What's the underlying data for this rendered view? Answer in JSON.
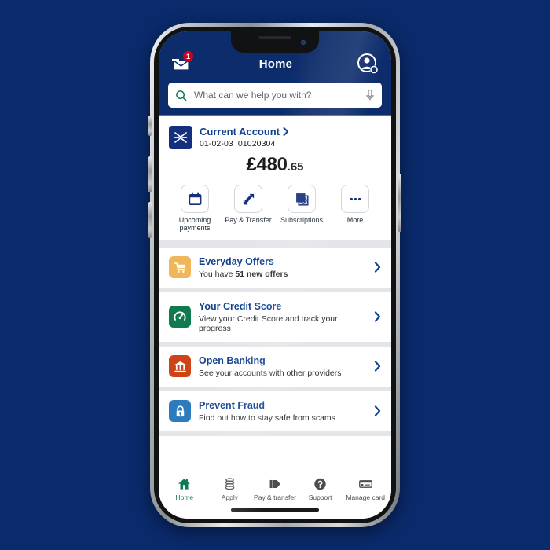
{
  "app": {
    "header": {
      "title": "Home",
      "mail_icon": "envelope-icon",
      "mail_badge": "1",
      "profile_icon": "profile-settings-icon"
    },
    "search": {
      "icon": "search-icon",
      "placeholder": "What can we help you with?",
      "mic_icon": "microphone-icon"
    },
    "account_card": {
      "brand_icon": "bank-emblem-icon",
      "name": "Current Account",
      "chevron": "chevron-right-icon",
      "sort_code": "01-02-03",
      "account_number": "01020304",
      "balance_main": "£480",
      "balance_pence": ".65",
      "actions": [
        {
          "label": "Upcoming payments",
          "icon": "calendar-icon"
        },
        {
          "label": "Pay & Transfer",
          "icon": "arrows-transfer-icon"
        },
        {
          "label": "Subscriptions",
          "icon": "subscriptions-icon"
        },
        {
          "label": "More",
          "icon": "ellipsis-icon"
        }
      ]
    },
    "rows": [
      {
        "title": "Everyday Offers",
        "sub_pre": "You have ",
        "sub_bold": "51 new offers",
        "sub_post": "",
        "icon": "shopping-cart-icon",
        "icon_color": "#f0b65a",
        "chevron": "chevron-right-icon"
      },
      {
        "title": "Your Credit Score",
        "sub_pre": "View your Credit Score and track your progress",
        "sub_bold": "",
        "sub_post": "",
        "icon": "speedometer-icon",
        "icon_color": "#0f7a4e",
        "chevron": "chevron-right-icon"
      },
      {
        "title": "Open Banking",
        "sub_pre": "See your accounts with other providers",
        "sub_bold": "",
        "sub_post": "",
        "icon": "bank-building-icon",
        "icon_color": "#cf4417",
        "chevron": "chevron-right-icon"
      },
      {
        "title": "Prevent Fraud",
        "sub_pre": "Find out how to stay safe from scams",
        "sub_bold": "",
        "sub_post": "",
        "icon": "padlock-icon",
        "icon_color": "#2c7bbf",
        "chevron": "chevron-right-icon"
      }
    ],
    "tabs": [
      {
        "label": "Home",
        "icon": "home-icon",
        "active": true
      },
      {
        "label": "Apply",
        "icon": "coins-stack-icon",
        "active": false
      },
      {
        "label": "Pay & transfer",
        "icon": "arrow-payment-icon",
        "active": false
      },
      {
        "label": "Support",
        "icon": "question-circle-icon",
        "active": false
      },
      {
        "label": "Manage card",
        "icon": "credit-card-icon",
        "active": false
      }
    ]
  },
  "colors": {
    "page_background": "#0a2a6b",
    "header_navy": "#0d2c6b",
    "brand_blue": "#11418f",
    "accent_green": "#0f9b6c",
    "active_tab_green": "#0f7a56",
    "badge_red": "#d0021b"
  }
}
